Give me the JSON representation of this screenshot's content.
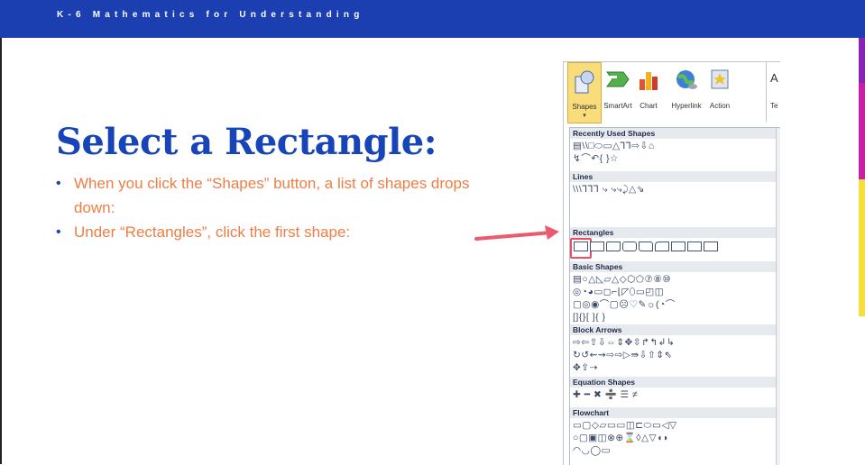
{
  "header": {
    "title": "K-6 Mathematics for Understanding"
  },
  "slide": {
    "title": "Select a Rectangle:",
    "bullets": [
      "When you click the “Shapes” button, a list of shapes drops down:",
      "Under “Rectangles”, click the first shape:"
    ]
  },
  "ribbon": {
    "buttons": [
      {
        "label": "Shapes",
        "icon": "shapes-icon"
      },
      {
        "label": "SmartArt",
        "icon": "smartart-icon"
      },
      {
        "label": "Chart",
        "icon": "chart-icon"
      },
      {
        "label": "Hyperlink",
        "icon": "hyperlink-icon"
      },
      {
        "label": "Action",
        "icon": "action-icon"
      },
      {
        "label": "Te",
        "icon": "textbox-icon"
      }
    ]
  },
  "shapes_menu": {
    "sections": [
      {
        "name": "Recently Used Shapes",
        "rows": [
          "▤\\\\□⬭▭△⅂⅂⇨⇩⌂",
          "↯⌒↶{ }☆"
        ]
      },
      {
        "name": "Lines",
        "rows": [
          "\\\\\\⅂⅂⅂ ⤷ ⤷⤷⤸△⇘"
        ]
      },
      {
        "name": "Rectangles",
        "rows": []
      },
      {
        "name": "Basic Shapes",
        "rows": [
          "▤○△◺▱△◇⬡⬠⑦⑧⑩",
          "◎◔◕▭◻⌐⌊◸⬯▭◰◫",
          "▢◎◉⌒▢☹♡✎☼(◔⌒",
          "[]{}[ ]{ }"
        ]
      },
      {
        "name": "Block Arrows",
        "rows": [
          "⇨⇦⇧⇩⇔⇕✥⇳↱↰↲↳",
          "↻↺⇜⇝⇨⇨▷⇛⇩⇧⇕⇖",
          "✥⇪⇢"
        ]
      },
      {
        "name": "Equation Shapes",
        "rows": [
          "✚ ━ ✖ ➗ ☰ ≠"
        ]
      },
      {
        "name": "Flowchart",
        "rows": [
          "▭▢◇▱▭▭◫⊏⬭▭◁▽",
          "○▢▣◫⊗⊕⌛◊△▽◖◗",
          "◠◡◯▭"
        ]
      }
    ],
    "rectangles_count": 9
  },
  "colors": {
    "header": "#1b3fb0",
    "title": "#1745b8",
    "bullet_text": "#ef7d44",
    "arrow": "#ec5a6e",
    "accent_purple": "#8a22b5",
    "accent_yellow": "#f6df3d",
    "accent_pink": "#e81f8e"
  }
}
